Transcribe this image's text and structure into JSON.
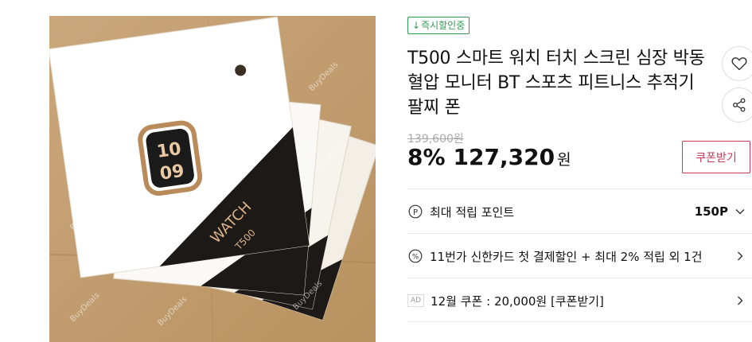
{
  "product_image": {
    "alt": "T500 smart watch boxes",
    "watermark": "BuyDeals",
    "watch_face_digits": [
      "10",
      "09"
    ],
    "box_label_main": "WATCH",
    "box_label_model": "T500"
  },
  "badge": {
    "arrow": "↓",
    "text": "즉시할인중"
  },
  "title": "T500 스마트 워치 터치 스크린 심장 박동 혈압 모니터 BT 스포츠 피트니스 추적기 팔찌 폰",
  "actions": {
    "like_icon": "heart-icon",
    "share_icon": "share-icon"
  },
  "price": {
    "original": "139,600원",
    "discount": "8%",
    "current": "127,320",
    "unit": "원"
  },
  "coupon_button": "쿠폰받기",
  "benefits": [
    {
      "icon": "point-icon",
      "label": "최대 적립 포인트",
      "value": "150P",
      "chevron": "chevron-down-icon"
    },
    {
      "icon": "percent-icon",
      "label": "11번가 신한카드 첫 결제할인 + 최대 2% 적립 외 1건",
      "value": "",
      "chevron": "chevron-right-icon"
    },
    {
      "icon": "ad-tag",
      "tag": "AD",
      "label": "12월 쿠폰 : 20,000원 [쿠폰받기]",
      "value": "",
      "chevron": "chevron-right-icon"
    }
  ],
  "colors": {
    "accent": "#c83a57",
    "badge_green": "#2e9e53",
    "strike_gray": "#aaaaaa",
    "divider": "#e8e8e8"
  }
}
